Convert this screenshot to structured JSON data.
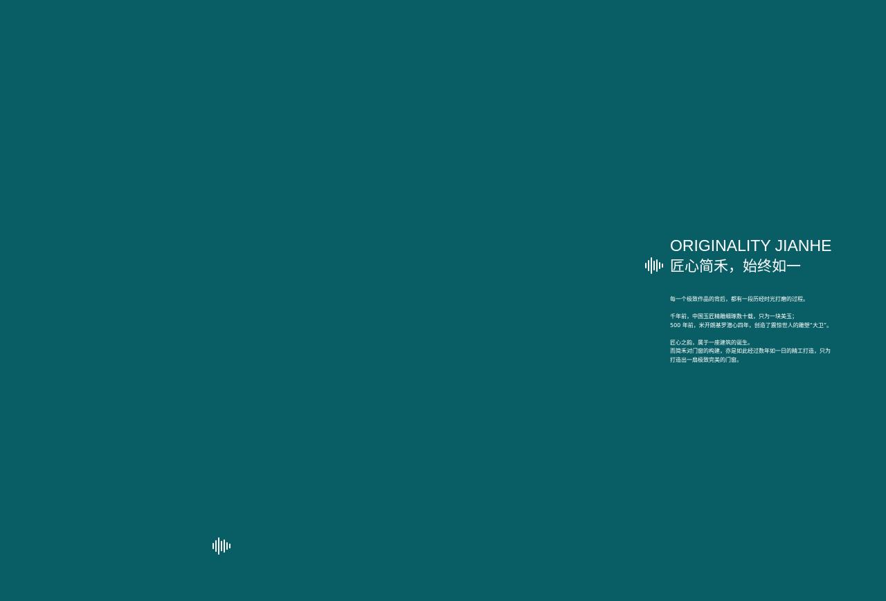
{
  "page": {
    "background": "#095e66",
    "text_color": "#ffffff",
    "logo_icon": "sound-wave-icon"
  },
  "heading": {
    "title_en": "ORIGINALITY JIANHE",
    "title_cn": "匠心简禾，始终如一"
  },
  "body": {
    "para1": [
      "每一个极致作品的背后，都有一段历经时光打磨的过程。"
    ],
    "para2": [
      "千年前，中国玉匠精雕细琢数十载，只为一块美玉；",
      "500 年前，米开朗基罗潜心四年，创造了震惊世人的雕塑“大卫”。"
    ],
    "para3": [
      "匠心之韵，属于一座建筑的诞生。",
      "而简禾对门窗的构建，亦是如此经过数年如一日的精工打造，只为",
      "打造出一扇极致完美的门窗。"
    ]
  }
}
